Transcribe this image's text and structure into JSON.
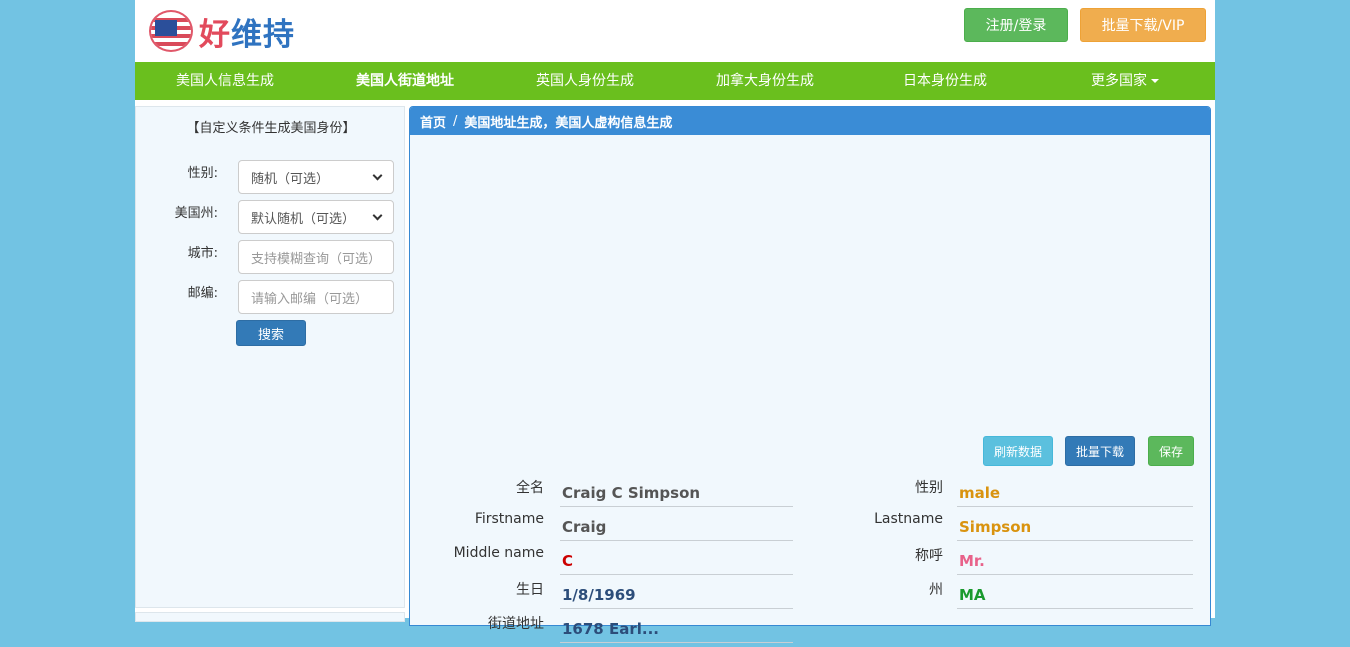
{
  "header": {
    "logo_text_part1": "好",
    "logo_text_part2": "维持",
    "login_label": "注册/登录",
    "vip_label": "批量下载/VIP"
  },
  "nav": {
    "items": [
      {
        "label": "美国人信息生成"
      },
      {
        "label": "美国人街道地址"
      },
      {
        "label": "英国人身份生成"
      },
      {
        "label": "加拿大身份生成"
      },
      {
        "label": "日本身份生成"
      },
      {
        "label": "更多国家"
      }
    ]
  },
  "sidebar": {
    "title": "【自定义条件生成美国身份】",
    "gender_label": "性别:",
    "gender_value": "随机（可选）",
    "state_label": "美国州:",
    "state_value": "默认随机（可选）",
    "city_label": "城市:",
    "city_placeholder": "支持模糊查询（可选）",
    "zip_label": "邮编:",
    "zip_placeholder": "请输入邮编（可选）",
    "search_label": "搜索"
  },
  "main": {
    "breadcrumb_home": "首页",
    "breadcrumb_sep": "/",
    "breadcrumb_current": "美国地址生成，美国人虚构信息生成",
    "refresh_label": "刷新数据",
    "batch_label": "批量下载",
    "save_label": "保存"
  },
  "fields": {
    "fullname_label": "全名",
    "fullname_value": "Craig C Simpson",
    "gender_label": "性别",
    "gender_value": "male",
    "firstname_label": "Firstname",
    "firstname_value": "Craig",
    "lastname_label": "Lastname",
    "lastname_value": "Simpson",
    "middlename_label": "Middle name",
    "middlename_value": "C",
    "title_label": "称呼",
    "title_value": "Mr.",
    "birthday_label": "生日",
    "birthday_value": "1/8/1969",
    "state_label": "州",
    "state_value": "MA",
    "street_label": "街道地址",
    "street_value": "1678 Earl..."
  },
  "colors": {
    "nav_green": "#6abf1e",
    "panel_blue": "#3a8cd6",
    "value_gray": "#555555",
    "value_orange": "#d9930f",
    "value_red": "#cc0000",
    "value_pink": "#e8628a",
    "value_navy": "#2c4d7a",
    "value_green": "#1a9a2e"
  }
}
